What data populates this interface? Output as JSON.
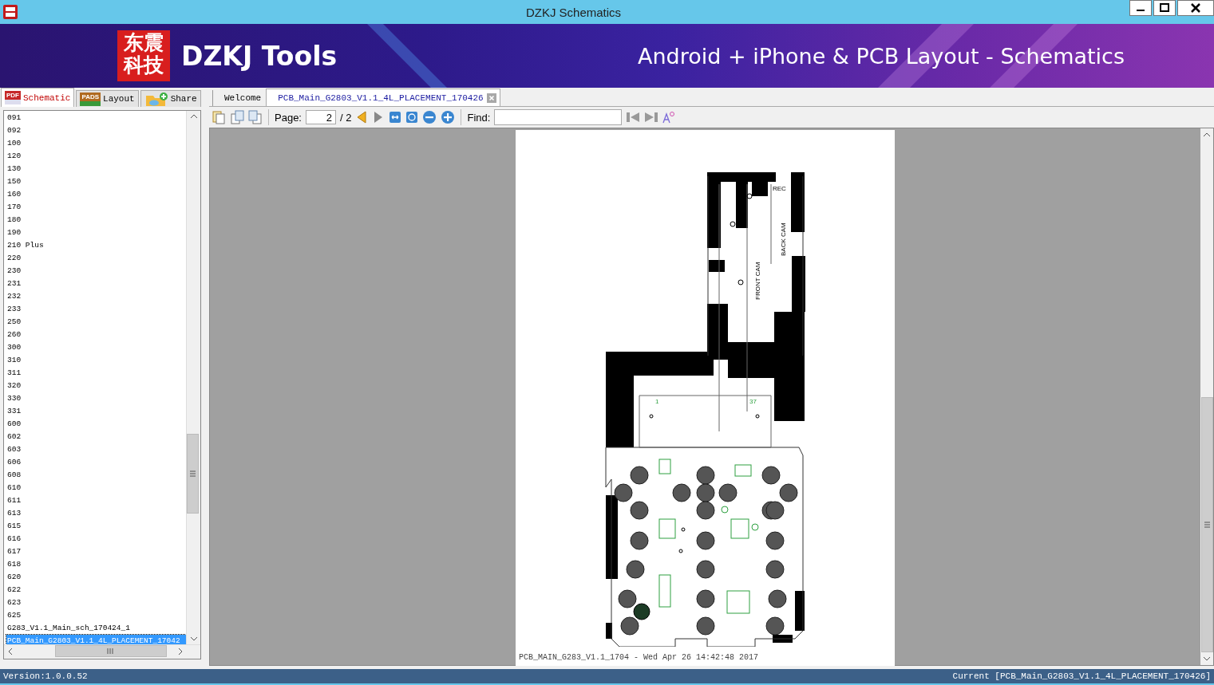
{
  "window": {
    "title": "DZKJ Schematics"
  },
  "banner": {
    "logo_chars": "东震科技",
    "brand": "DZKJ Tools",
    "tagline": "Android + iPhone & PCB Layout - Schematics"
  },
  "side_tabs": [
    {
      "label": "Schematic",
      "badge": "PDF",
      "selected": true
    },
    {
      "label": "Layout",
      "badge": "PADS",
      "selected": false
    },
    {
      "label": "Share",
      "selected": false
    }
  ],
  "file_list": [
    {
      "label": "091",
      "selected": false
    },
    {
      "label": "092",
      "selected": false
    },
    {
      "label": "100",
      "selected": false
    },
    {
      "label": "120",
      "selected": false
    },
    {
      "label": "130",
      "selected": false
    },
    {
      "label": "150",
      "selected": false
    },
    {
      "label": "160",
      "selected": false
    },
    {
      "label": "170",
      "selected": false
    },
    {
      "label": "180",
      "selected": false
    },
    {
      "label": "190",
      "selected": false
    },
    {
      "label": "210 Plus",
      "selected": false
    },
    {
      "label": "220",
      "selected": false
    },
    {
      "label": "230",
      "selected": false
    },
    {
      "label": "231",
      "selected": false
    },
    {
      "label": "232",
      "selected": false
    },
    {
      "label": "233",
      "selected": false
    },
    {
      "label": "250",
      "selected": false
    },
    {
      "label": "260",
      "selected": false
    },
    {
      "label": "300",
      "selected": false
    },
    {
      "label": "310",
      "selected": false
    },
    {
      "label": "311",
      "selected": false
    },
    {
      "label": "320",
      "selected": false
    },
    {
      "label": "330",
      "selected": false
    },
    {
      "label": "331",
      "selected": false
    },
    {
      "label": "600",
      "selected": false
    },
    {
      "label": "602",
      "selected": false
    },
    {
      "label": "603",
      "selected": false
    },
    {
      "label": "606",
      "selected": false
    },
    {
      "label": "608",
      "selected": false
    },
    {
      "label": "610",
      "selected": false
    },
    {
      "label": "611",
      "selected": false
    },
    {
      "label": "613",
      "selected": false
    },
    {
      "label": "615",
      "selected": false
    },
    {
      "label": "616",
      "selected": false
    },
    {
      "label": "617",
      "selected": false
    },
    {
      "label": "618",
      "selected": false
    },
    {
      "label": "620",
      "selected": false
    },
    {
      "label": "622",
      "selected": false
    },
    {
      "label": "623",
      "selected": false
    },
    {
      "label": "625",
      "selected": false
    },
    {
      "label": "G283_V1.1_Main_sch_170424_1",
      "selected": false
    },
    {
      "label": "PCB_Main_G2803_V1.1_4L_PLACEMENT_17042",
      "selected": true
    }
  ],
  "doc_tabs": [
    {
      "label": "Welcome",
      "selected": false,
      "closable": false
    },
    {
      "label": "PCB_Main_G2803_V1.1_4L_PLACEMENT_170426",
      "selected": true,
      "closable": true
    }
  ],
  "toolbar": {
    "page_label": "Page:",
    "page_value": "2",
    "page_total": "/ 2",
    "find_label": "Find:"
  },
  "document": {
    "labels": [
      "REC",
      "BACK CAM",
      "FRONT CAM",
      "1",
      "37"
    ],
    "footer": "PCB_MAIN_G283_V1.1_1704 - Wed Apr 26 14:42:48 2017"
  },
  "status_bar": {
    "version": "Version:1.0.0.52",
    "current": "Current [PCB_Main_G2803_V1.1_4L_PLACEMENT_170426]"
  }
}
